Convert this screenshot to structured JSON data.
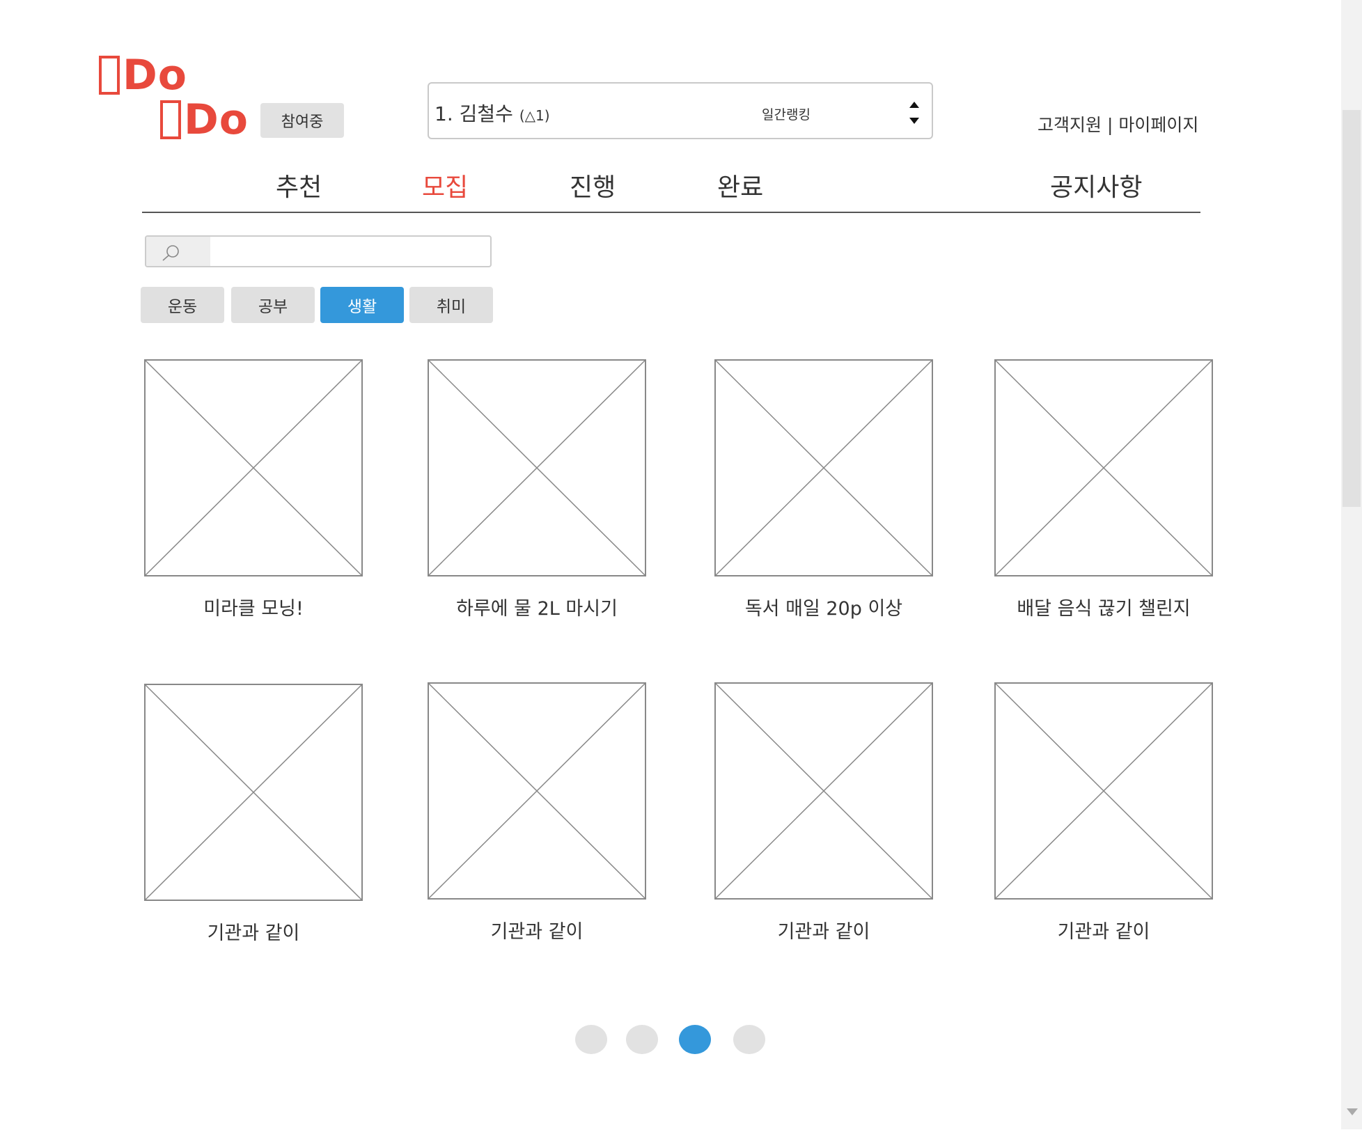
{
  "logo": {
    "line1": "Do",
    "line2": "Do"
  },
  "header": {
    "joined_label": "참여중",
    "ranking": {
      "entry": "1. 김철수",
      "change": "(△1)",
      "type_label": "일간랭킹"
    },
    "links": {
      "support": "고객지원",
      "separator": " | ",
      "mypage": "마이페이지"
    }
  },
  "nav": {
    "tabs": [
      {
        "label": "추천"
      },
      {
        "label": "모집"
      },
      {
        "label": "진행"
      },
      {
        "label": "완료"
      },
      {
        "label": "공지사항"
      }
    ],
    "active_tab": "모집"
  },
  "search": {
    "placeholder": "",
    "value": ""
  },
  "categories": {
    "items": [
      {
        "label": "운동"
      },
      {
        "label": "공부"
      },
      {
        "label": "생활"
      },
      {
        "label": "취미"
      }
    ],
    "active": "생활"
  },
  "cards": [
    {
      "title": "미라클 모닝!"
    },
    {
      "title": "하루에 물 2L 마시기"
    },
    {
      "title": "독서 매일 20p 이상"
    },
    {
      "title": "배달 음식 끊기 챌린지"
    },
    {
      "title": "기관과 같이"
    },
    {
      "title": "기관과 같이"
    },
    {
      "title": "기관과 같이"
    },
    {
      "title": "기관과 같이"
    }
  ],
  "pagination": {
    "pages": 4,
    "current": 3
  },
  "colors": {
    "brand": "#e8493c",
    "accent": "#3498db",
    "button_gray": "#e0e0e0"
  },
  "icons": {
    "search": "search-icon",
    "spinner": "up-down-arrows-icon",
    "placeholder": "image-placeholder-icon"
  }
}
